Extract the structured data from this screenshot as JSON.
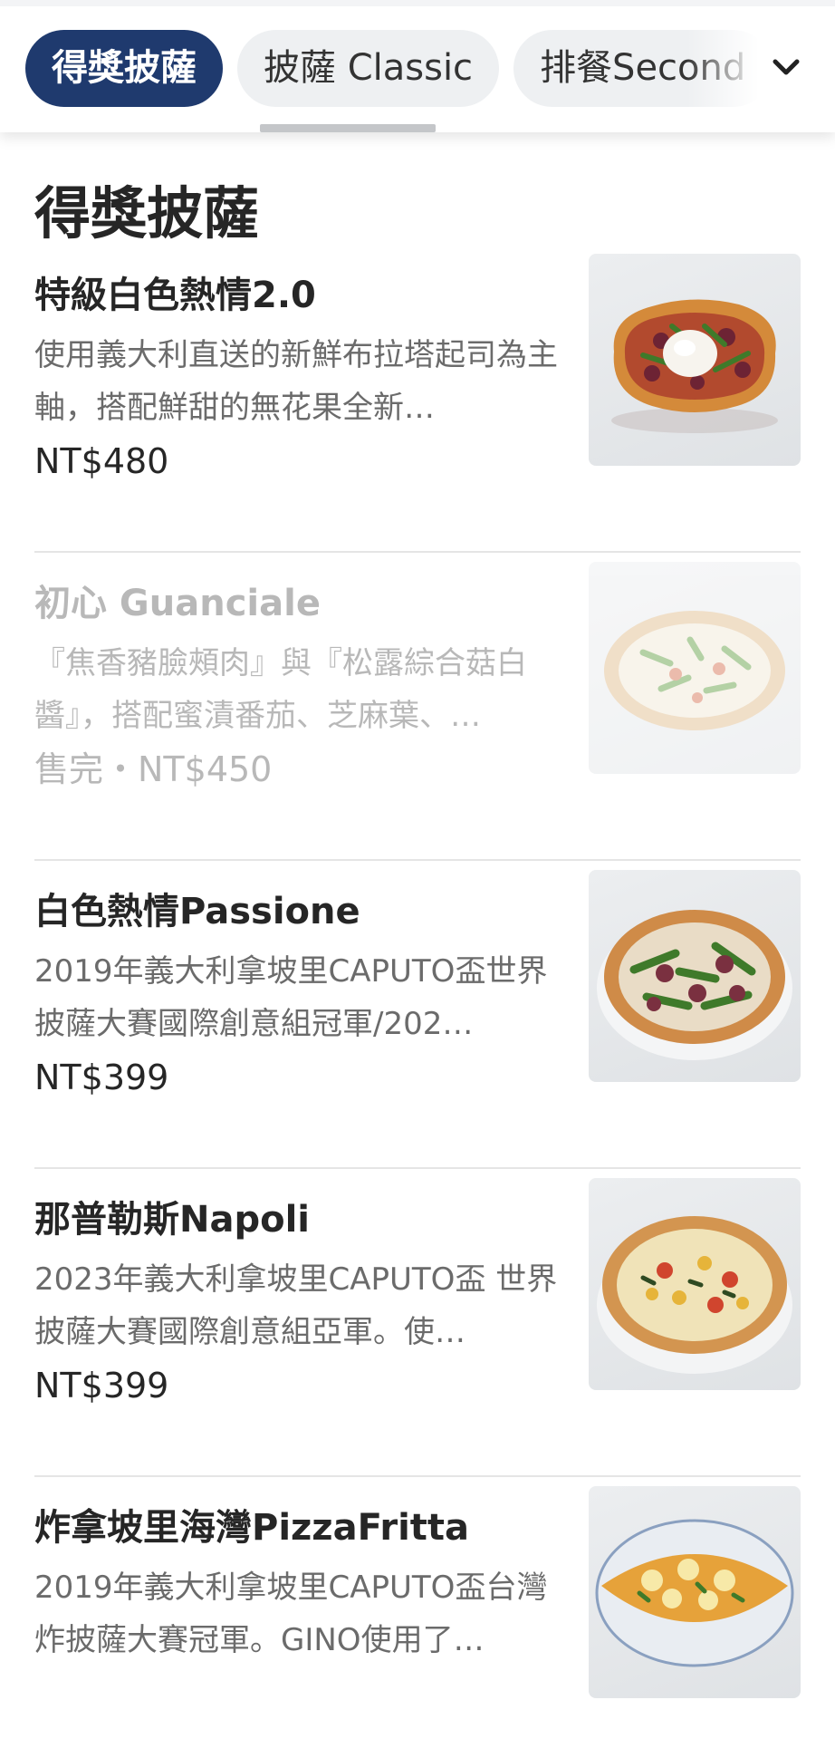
{
  "tabs": [
    {
      "label": "得獎披薩",
      "active": true
    },
    {
      "label": "披薩 Classic",
      "active": false
    },
    {
      "label": "排餐Second",
      "active": false
    }
  ],
  "section": {
    "title": "得獎披薩"
  },
  "items": [
    {
      "name": "特級白色熱情2.0",
      "desc": "使用義大利直送的新鮮布拉塔起司為主軸，搭配鮮甜的無花果全新…",
      "price": "NT$480",
      "sold_out": false,
      "image": "pizza-burrata-fig"
    },
    {
      "name": "初心 Guanciale",
      "desc": "『焦香豬臉頰肉』與『松露綜合菇白醬』，搭配蜜漬番茄、芝麻葉、…",
      "price": "售完・NT$450",
      "sold_out": true,
      "image": "pizza-guanciale"
    },
    {
      "name": "白色熱情Passione",
      "desc": "2019年義大利拿坡里CAPUTO盃世界披薩大賽國際創意組冠軍/202…",
      "price": "NT$399",
      "sold_out": false,
      "image": "pizza-passione"
    },
    {
      "name": "那普勒斯Napoli",
      "desc": "2023年義大利拿坡里CAPUTO盃 世界披薩大賽國際創意組亞軍。使…",
      "price": "NT$399",
      "sold_out": false,
      "image": "pizza-napoli"
    },
    {
      "name": "炸拿坡里海灣PizzaFritta",
      "desc": "2019年義大利拿坡里CAPUTO盃台灣炸披薩大賽冠軍。GINO使用了…",
      "price": "",
      "sold_out": false,
      "image": "pizza-fritta"
    }
  ],
  "colors": {
    "active_tab": "#1f3a6e",
    "inactive_tab": "#eef0f2",
    "text": "#262626",
    "muted_text": "#6b6b6b",
    "sold_out_text": "#b8b8b8"
  },
  "icons": {
    "tab_dropdown": "chevron-down-icon"
  }
}
